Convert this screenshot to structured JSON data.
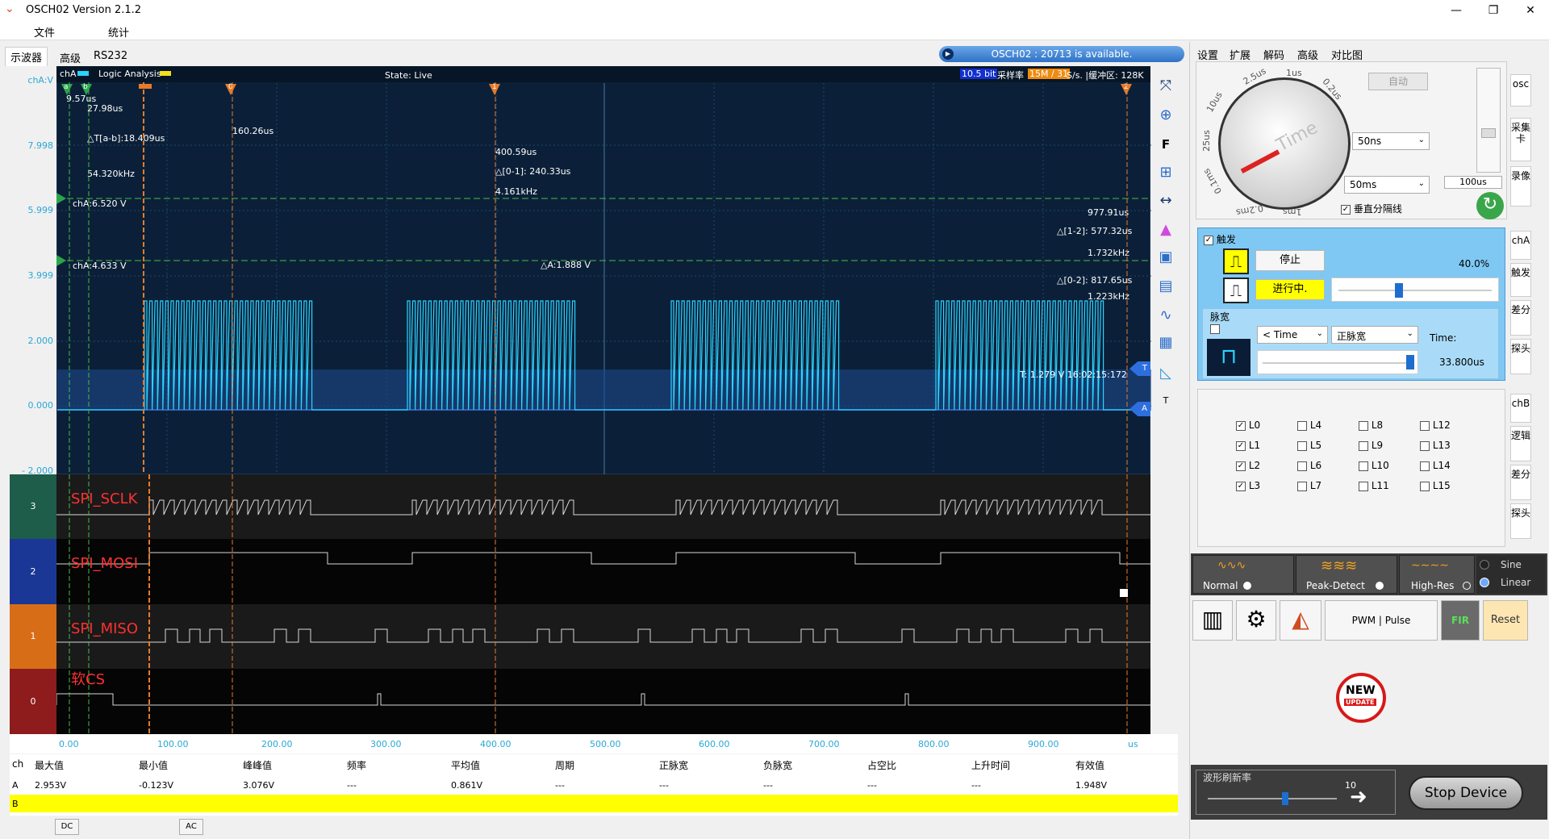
{
  "app": {
    "title": "OSCH02  Version 2.1.2",
    "window_buttons": [
      "—",
      "❐",
      "✕"
    ]
  },
  "menu": [
    "文件",
    "统计"
  ],
  "left_tabs": [
    "示波器",
    "高级",
    "RS232"
  ],
  "banner": "OSCH02 : 20713 is available.",
  "scope": {
    "ch_label": "chA",
    "logic_label": "Logic Analysis",
    "state": "State: Live",
    "bits": "10.5 bit",
    "sample_rate_label": "采样率",
    "sample_rate": "15M / 31",
    "sample_tail": "S/s. |缓冲区: 128K",
    "y_unit": "chA:V",
    "y_ticks": [
      "7.998",
      "5.999",
      "3.999",
      "2.000",
      "0.000",
      "- 2.000"
    ],
    "x_ticks": [
      "0.00",
      "100.00",
      "200.00",
      "300.00",
      "400.00",
      "500.00",
      "600.00",
      "700.00",
      "800.00",
      "900.00"
    ],
    "x_unit": "us",
    "cursor_labels": [
      "a",
      "b",
      "0",
      "1",
      "2"
    ],
    "annotations": {
      "a_time": "9.57us",
      "b_time": "27.98us",
      "dt_ab": "△T[a-b]:18.409us",
      "f_ab": "54.320kHz",
      "c0_time": "160.26us",
      "c1_time": "400.59us",
      "d01": "△[0-1]: 240.33us",
      "f01": "4.161kHz",
      "c2_time": "977.91us",
      "d12": "△[1-2]: 577.32us",
      "f12": "1.732kHz",
      "d02": "△[0-2]: 817.65us",
      "f02": "1.223kHz",
      "h1": "chA:6.520 V",
      "h2": "chA:4.633 V",
      "dA": "△A:1.888 V",
      "trigger": "T: 1.279 V   16:02:15:172",
      "marker_T": "T",
      "marker_A": "A"
    }
  },
  "lanes": [
    {
      "num": "3",
      "name": "SPI_SCLK"
    },
    {
      "num": "2",
      "name": "SPI_MOSI"
    },
    {
      "num": "1",
      "name": "SPI_MISO"
    },
    {
      "num": "0",
      "name": "软CS"
    }
  ],
  "toolbar": {
    "f_label": "F",
    "t_label": "T"
  },
  "measure": {
    "headers": [
      "ch",
      "最大值",
      "最小值",
      "峰峰值",
      "频率",
      "平均值",
      "周期",
      "正脉宽",
      "负脉宽",
      "占空比",
      "上升时间",
      "有效值"
    ],
    "rowA": [
      "A",
      "2.953V",
      "-0.123V",
      "3.076V",
      "---",
      "0.861V",
      "---",
      "---",
      "---",
      "---",
      "---",
      "1.948V"
    ],
    "rowB": "B"
  },
  "bottom_buttons": [
    "DC",
    "AC"
  ],
  "right": {
    "tabs": [
      "设置",
      "扩展",
      "解码",
      "高级",
      "对比图"
    ],
    "dial_labels": [
      "2.5us",
      "1us",
      "0.2us",
      "10us",
      "25us",
      "0.1ms",
      "0.2ms",
      "1ms"
    ],
    "dial_text": "Time",
    "auto": "自动",
    "timebase": "50ns",
    "timebase2": "50ms",
    "holdoff": "100us",
    "vdiv_label": "垂直分隔线",
    "trigger_label": "触发",
    "stop": "停止",
    "running": "进行中.",
    "trig_pct": "40.0%",
    "pulse_label": "脉宽",
    "pulse_cond": "< Time",
    "pulse_type": "正脉宽",
    "time_label": "Time:",
    "time_value": "33.800us",
    "side_tabs": [
      "osc",
      "采集卡",
      "录像",
      "chA",
      "触发",
      "差分",
      "探头",
      "chB",
      "逻辑",
      "差分",
      "探头"
    ],
    "logic_channels": [
      "L0",
      "L1",
      "L2",
      "L3",
      "L4",
      "L5",
      "L6",
      "L7",
      "L8",
      "L9",
      "L10",
      "L11",
      "L12",
      "L13",
      "L14",
      "L15"
    ],
    "logic_checked": [
      "L0",
      "L1",
      "L2",
      "L3"
    ],
    "acq_modes": [
      "Normal",
      "Peak-Detect",
      "High-Res"
    ],
    "wave_types": [
      "Sine",
      "Linear"
    ],
    "pwm": "PWM | Pulse",
    "fir": "FIR",
    "reset": "Reset",
    "new_badge": [
      "NEW",
      "UPDATE"
    ],
    "refresh_label": "波形刷新率",
    "refresh_value": "10",
    "stop_device": "Stop Device"
  },
  "colors": {
    "accent": "#2ad4ff",
    "cursor": "#e87a2a",
    "grid": "#1d4570",
    "lane3": "#1d5d4a",
    "lane2": "#1b3796",
    "lane1": "#d86d18",
    "lane0": "#8e1c1c"
  }
}
